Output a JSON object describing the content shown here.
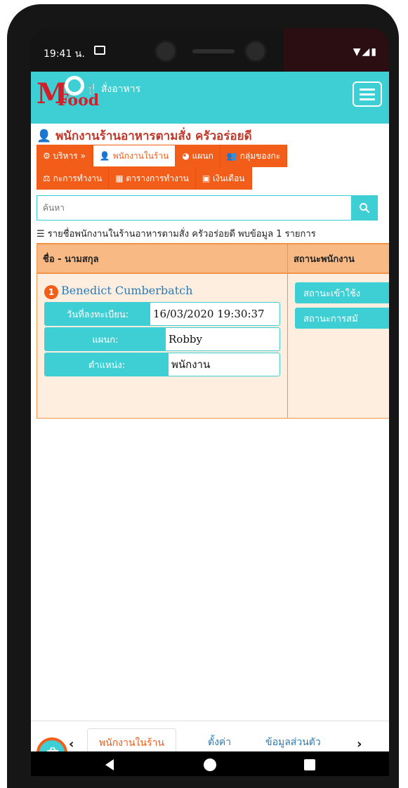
{
  "status_bar": {
    "time": "19:41 น."
  },
  "app_bar": {
    "logo_m": "M",
    "logo_food": "Food",
    "order_link": "สั่งอาหาร",
    "menu_icon": "hamburger-icon"
  },
  "page": {
    "title": "พนักงานร้านอาหารตามสั่ง ครัวอร่อยดี",
    "nav_tabs_row1": [
      {
        "label": "บริหาร »",
        "icon": "gear-icon"
      },
      {
        "label": "พนักงานในร้าน",
        "icon": "user-icon",
        "active": true
      },
      {
        "label": "แผนก",
        "icon": "pie-icon"
      },
      {
        "label": "กลุ่มของกะ",
        "icon": "users-icon"
      }
    ],
    "nav_tabs_row2": [
      {
        "label": "กะการทำงาน",
        "icon": "scale-icon"
      },
      {
        "label": "ตารางการทำงาน",
        "icon": "calendar-icon"
      },
      {
        "label": "เงินเดือน",
        "icon": "money-icon"
      }
    ],
    "search": {
      "placeholder": "ค้นหา"
    },
    "summary": "รายชื่อพนักงานในร้านอาหารตามสั่ง ครัวอร่อยดี พบข้อมูล 1 รายการ",
    "table": {
      "headers": [
        "ชื่อ - นามสกุล",
        "สถานะพนักงาน"
      ],
      "rows": [
        {
          "index": "1",
          "name": "Benedict Cumberbatch",
          "fields": [
            {
              "label": "วันที่ลงทะเบียน:",
              "value": "16/03/2020 19:30:37"
            },
            {
              "label": "แผนก:",
              "value": "Robby"
            },
            {
              "label": "ตำแหน่ง:",
              "value": "พนักงาน"
            }
          ],
          "status_buttons": [
            "สถานะเข้าใช้ง",
            "สถานะการสมั"
          ]
        }
      ]
    }
  },
  "bottom_bar": {
    "tabs": [
      "พนักงานในร้าน",
      "ตั้งค่า",
      "ข้อมูลส่วนตัว"
    ],
    "prev_arrow": "‹",
    "next_arrow": "›"
  },
  "colors": {
    "accent": "#3dcfd3",
    "orange": "#f25e1a",
    "title_red": "#c0392b"
  }
}
